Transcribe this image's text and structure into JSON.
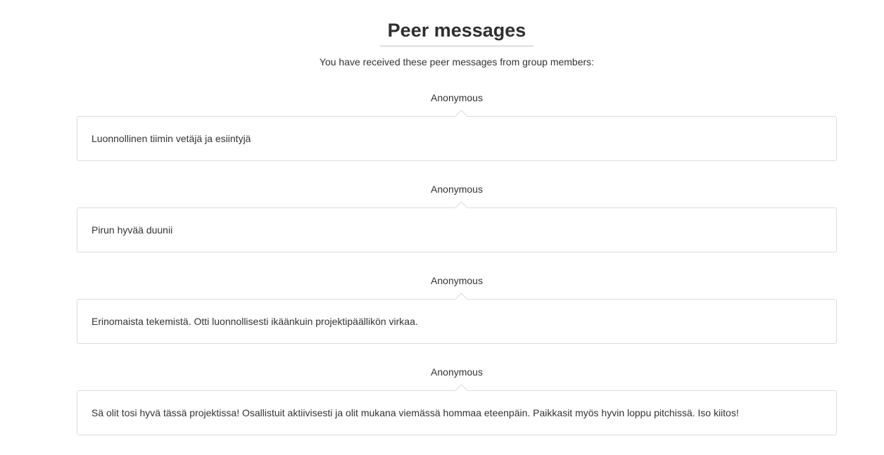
{
  "header": {
    "title": "Peer messages",
    "intro": "You have received these peer messages from group members:"
  },
  "messages": [
    {
      "sender": "Anonymous",
      "text": "Luonnollinen tiimin vetäjä ja esiintyjä"
    },
    {
      "sender": "Anonymous",
      "text": "Pirun hyvää duunii"
    },
    {
      "sender": "Anonymous",
      "text": "Erinomaista tekemistä. Otti luonnollisesti ikäänkuin projektipäällikön virkaa."
    },
    {
      "sender": "Anonymous",
      "text": "Sä olit tosi hyvä tässä projektissa! Osallistuit aktiivisesti ja olit mukana viemässä hommaa eteenpäin. Paikkasit myös hyvin loppu pitchissä. Iso kiitos!"
    }
  ]
}
